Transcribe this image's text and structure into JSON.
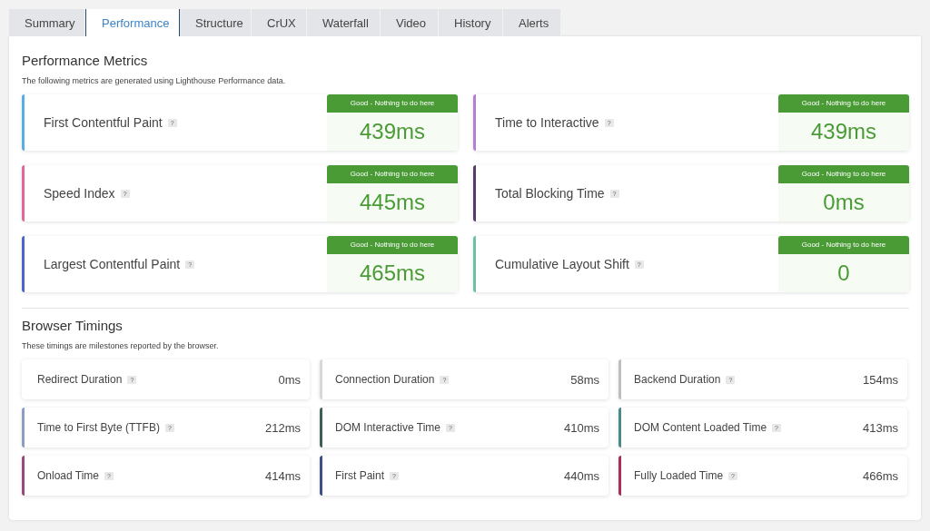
{
  "tabs": [
    {
      "label": "Summary",
      "selected": false
    },
    {
      "label": "Performance",
      "selected": true
    },
    {
      "label": "Structure",
      "selected": false
    },
    {
      "label": "CrUX",
      "selected": false
    },
    {
      "label": "Waterfall",
      "selected": false
    },
    {
      "label": "Video",
      "selected": false
    },
    {
      "label": "History",
      "selected": false
    },
    {
      "label": "Alerts",
      "selected": false
    }
  ],
  "performance_metrics": {
    "title": "Performance Metrics",
    "description": "The following metrics are generated using Lighthouse Performance data.",
    "metrics": [
      {
        "name": "First Contentful Paint",
        "help": "?",
        "status": "Good - Nothing to do here",
        "value": "439ms",
        "color": "#5aaee8"
      },
      {
        "name": "Time to Interactive",
        "help": "?",
        "status": "Good - Nothing to do here",
        "value": "439ms",
        "color": "#b57ed0"
      },
      {
        "name": "Speed Index",
        "help": "?",
        "status": "Good - Nothing to do here",
        "value": "445ms",
        "color": "#e0689c"
      },
      {
        "name": "Total Blocking Time",
        "help": "?",
        "status": "Good - Nothing to do here",
        "value": "0ms",
        "color": "#5a3a6a"
      },
      {
        "name": "Largest Contentful Paint",
        "help": "?",
        "status": "Good - Nothing to do here",
        "value": "465ms",
        "color": "#4a66c8"
      },
      {
        "name": "Cumulative Layout Shift",
        "help": "?",
        "status": "Good - Nothing to do here",
        "value": "0",
        "color": "#6cc0a4"
      }
    ]
  },
  "browser_timings": {
    "title": "Browser Timings",
    "description": "These timings are milestones reported by the browser.",
    "timings": [
      {
        "name": "Redirect Duration",
        "help": "?",
        "value": "0ms"
      },
      {
        "name": "Connection Duration",
        "help": "?",
        "value": "58ms",
        "color": "#d8d8d8"
      },
      {
        "name": "Backend Duration",
        "help": "?",
        "value": "154ms",
        "color": "#c0bcc0"
      },
      {
        "name": "Time to First Byte (TTFB)",
        "help": "?",
        "value": "212ms",
        "color": "#8c9cc4"
      },
      {
        "name": "DOM Interactive Time",
        "help": "?",
        "value": "410ms",
        "color": "#3e5e58"
      },
      {
        "name": "DOM Content Loaded Time",
        "help": "?",
        "value": "413ms",
        "color": "#4a8a88"
      },
      {
        "name": "Onload Time",
        "help": "?",
        "value": "414ms",
        "color": "#9a4a7a"
      },
      {
        "name": "First Paint",
        "help": "?",
        "value": "440ms",
        "color": "#3e4e86"
      },
      {
        "name": "Fully Loaded Time",
        "help": "?",
        "value": "466ms",
        "color": "#a83058"
      }
    ]
  }
}
